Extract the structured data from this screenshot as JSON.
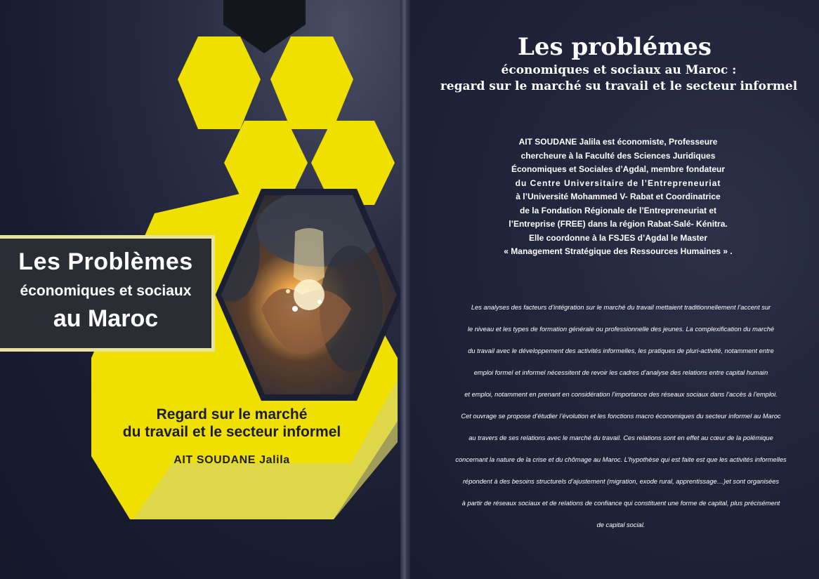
{
  "cover": {
    "title_line1": "Les Problèmes",
    "title_line2": "économiques et sociaux",
    "title_line3": "au Maroc",
    "subtitle_line1": "Regard sur le marché",
    "subtitle_line2": "du travail et le secteur informel",
    "author": "AIT SOUDANE Jalila",
    "illustration": "hands-holding-light-bulb",
    "colors": {
      "accent_yellow": "#efe000",
      "dark_navy": "#1b1f34",
      "title_box": "#2a2d33"
    }
  },
  "back": {
    "title": "Les problémes",
    "subtitle_line1": "économiques et sociaux au Maroc :",
    "subtitle_line2": "regard sur le marché su travail et le secteur informel",
    "bio_lines": [
      "AIT SOUDANE Jalila   est économiste,  Professeure",
      "chercheure à la Faculté  des Sciences Juridiques",
      "Économiques et Sociales  d’Agdal,  membre fondateur",
      "du Centre Universitaire de l’Entrepreneuriat",
      "à l’Université Mohammed V- Rabat et Coordinatrice",
      "de la Fondation Régionale de l’Entrepreneuriat et",
      "l’Entreprise  (FREE) dans la région Rabat-Salé- Kénitra.",
      "Elle coordonne   à  la FSJES d’Agdal  le Master",
      "« Management Stratégique des Ressources Humaines  » ."
    ],
    "summary_lines": [
      "Les analyses des facteurs d’intégration sur le marché du travail mettaient traditionnellement l’accent sur",
      "le niveau et les types de formation générale ou professionnelle des jeunes. La complexification du marché",
      "du travail avec le développement des activités informelles, les pratiques de pluri-activité, notamment entre",
      "emploi formel et informel nécessitent de revoir les cadres d’analyse des relations entre capital humain",
      "et emploi, notamment en prenant en considération l’importance des réseaux sociaux dans l’accès à l’emploi.",
      "Cet ouvrage se propose d’étudier l’évolution et les fonctions macro économiques du secteur informel  au Maroc",
      "au travers de ses relations avec le marché du travail. Ces relations sont en effet au cœur de la polémique",
      "concernant la nature de la crise et du chômage au Maroc. L’hypothèse qui est faite est que les activités informelles",
      "répondent à des besoins structurels d’ajustement (migration, exode rural, apprentissage…)et sont organisées",
      "à partir de réseaux sociaux et de relations de confiance qui constituent une forme de capital, plus précisément",
      "de capital social."
    ]
  }
}
